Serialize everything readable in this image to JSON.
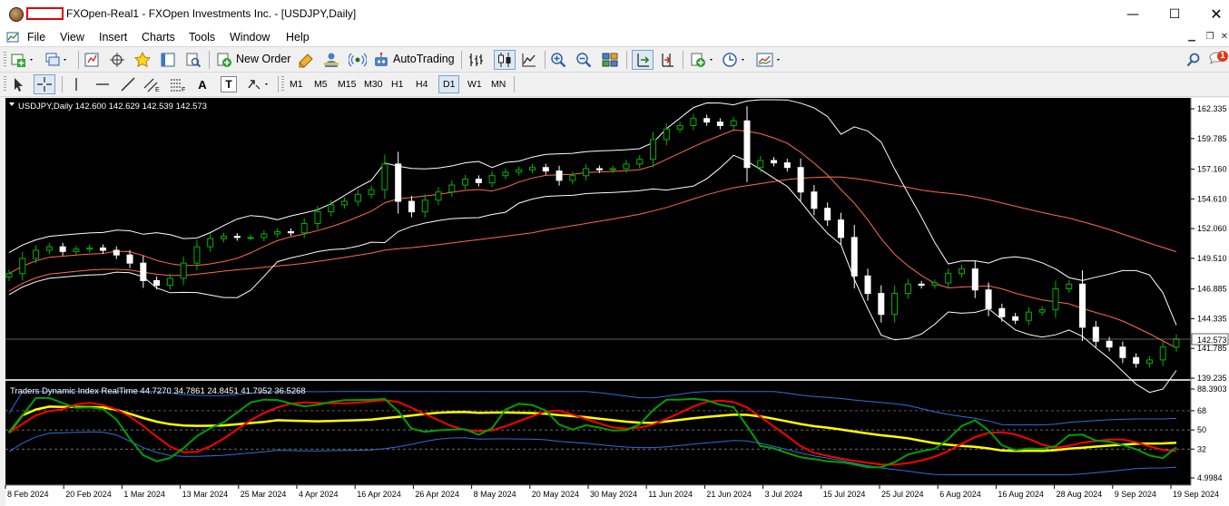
{
  "window": {
    "title": "FXOpen-Real1 - FXOpen Investments Inc. - [USDJPY,Daily]",
    "minimize_glyph": "—",
    "maximize_glyph": "☐",
    "close_glyph": "✕"
  },
  "menu": {
    "items": [
      "File",
      "View",
      "Insert",
      "Charts",
      "Tools",
      "Window",
      "Help"
    ]
  },
  "toolbar": {
    "new_order_label": "New Order",
    "autotrading_label": "AutoTrading",
    "notification_count": "1"
  },
  "timeframes": [
    "M1",
    "M5",
    "M15",
    "M30",
    "H1",
    "H4",
    "D1",
    "W1",
    "MN"
  ],
  "active_timeframe": "D1",
  "drawing_tools": {
    "text_glyph": "A",
    "label_glyph": "T"
  },
  "colors": {
    "bull_candle": "#00b400",
    "bear_candle": "#ffffff",
    "bollinger": "#ffffff",
    "ma_slow": "#ff6a4a",
    "tdi_green": "#00a000",
    "tdi_red": "#ff0000",
    "tdi_yellow": "#ffff00",
    "tdi_bands": "#2e6edc"
  },
  "chart_data": [
    {
      "type": "candlestick",
      "header": "USDJPY,Daily  142.600 142.629 142.539 142.573",
      "symbol": "USDJPY",
      "timeframe": "Daily",
      "ohlc_current": {
        "open": 142.6,
        "high": 142.629,
        "low": 142.539,
        "close": 142.573
      },
      "ylim": [
        139.235,
        162.335
      ],
      "y_ticks": [
        "162.335",
        "159.785",
        "157.160",
        "154.610",
        "152.060",
        "149.510",
        "146.885",
        "144.335",
        "141.785",
        "139.235"
      ],
      "current_price_label": "142.573",
      "close_series_approx": [
        148.2,
        149.5,
        150.2,
        150.5,
        150.1,
        150.3,
        150.4,
        150.2,
        149.8,
        149.1,
        147.6,
        147.2,
        147.8,
        149.1,
        150.5,
        151.2,
        151.4,
        151.3,
        151.3,
        151.6,
        151.8,
        151.7,
        152.5,
        153.5,
        154.1,
        154.4,
        155.0,
        155.4,
        157.6,
        154.4,
        153.5,
        154.5,
        155.2,
        155.8,
        156.3,
        156.0,
        156.6,
        156.9,
        157.1,
        157.3,
        157.0,
        156.2,
        156.6,
        157.2,
        157.1,
        157.2,
        157.6,
        158.0,
        159.7,
        160.6,
        160.9,
        161.5,
        161.2,
        160.9,
        161.3,
        157.3,
        157.9,
        157.7,
        157.3,
        155.2,
        153.8,
        152.8,
        151.3,
        148.0,
        146.5,
        144.7,
        146.5,
        147.3,
        147.2,
        147.4,
        148.2,
        148.6,
        146.8,
        145.2,
        144.5,
        144.2,
        144.9,
        145.1,
        146.9,
        147.3,
        143.6,
        142.4,
        141.9,
        141.0,
        140.5,
        140.8,
        141.9,
        142.573
      ]
    },
    {
      "type": "line",
      "header": "Traders Dynamic Index RealTime 44.7270 34.7861 24.8451 41.7952 36.5268",
      "indicator": "Traders Dynamic Index RealTime",
      "values": [
        44.727,
        34.7861,
        24.8451,
        41.7952,
        36.5268
      ],
      "ylim": [
        4.9984,
        88.3903
      ],
      "y_ticks": [
        "88.3903",
        "68",
        "50",
        "32",
        "4.9984"
      ]
    }
  ],
  "x_axis": {
    "labels": [
      "8 Feb 2024",
      "20 Feb 2024",
      "1 Mar 2024",
      "13 Mar 2024",
      "25 Mar 2024",
      "4 Apr 2024",
      "16 Apr 2024",
      "26 Apr 2024",
      "8 May 2024",
      "20 May 2024",
      "30 May 2024",
      "11 Jun 2024",
      "21 Jun 2024",
      "3 Jul 2024",
      "15 Jul 2024",
      "25 Jul 2024",
      "6 Aug 2024",
      "16 Aug 2024",
      "28 Aug 2024",
      "9 Sep 2024",
      "19 Sep 2024"
    ]
  }
}
